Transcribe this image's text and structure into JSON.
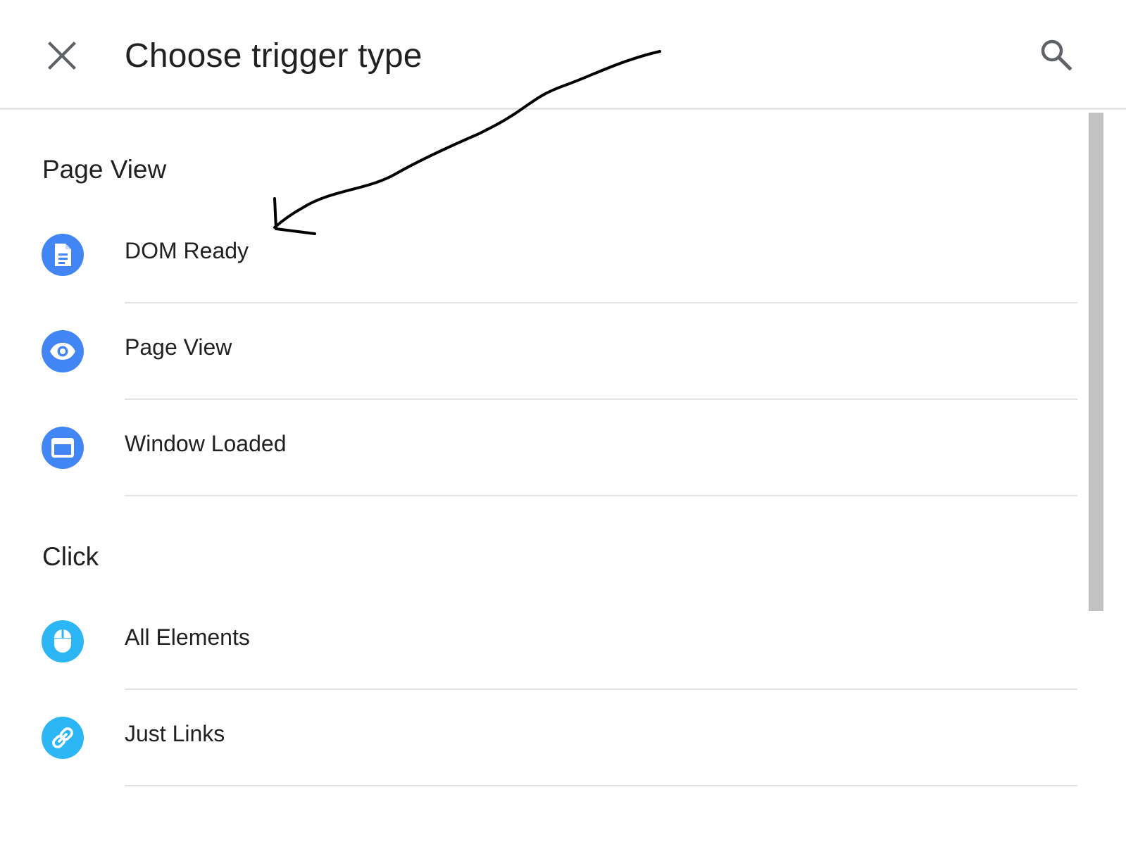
{
  "header": {
    "title": "Choose trigger type",
    "close_icon": "close-icon",
    "search_icon": "search-icon"
  },
  "sections": [
    {
      "heading": "Page View",
      "items": [
        {
          "label": "DOM Ready",
          "icon": "document-icon",
          "color": "#4285f4"
        },
        {
          "label": "Page View",
          "icon": "eye-icon",
          "color": "#4285f4"
        },
        {
          "label": "Window Loaded",
          "icon": "window-icon",
          "color": "#4285f4"
        }
      ]
    },
    {
      "heading": "Click",
      "items": [
        {
          "label": "All Elements",
          "icon": "mouse-icon",
          "color": "#2db6f5"
        },
        {
          "label": "Just Links",
          "icon": "link-icon",
          "color": "#2db6f5"
        }
      ]
    }
  ],
  "colors": {
    "page_view_accent": "#4285f4",
    "click_accent": "#2db6f5",
    "divider": "#e3e3e3",
    "annotation_stroke": "#000000"
  },
  "annotation": {
    "type": "hand-drawn-arrow",
    "points_to": "DOM Ready"
  }
}
